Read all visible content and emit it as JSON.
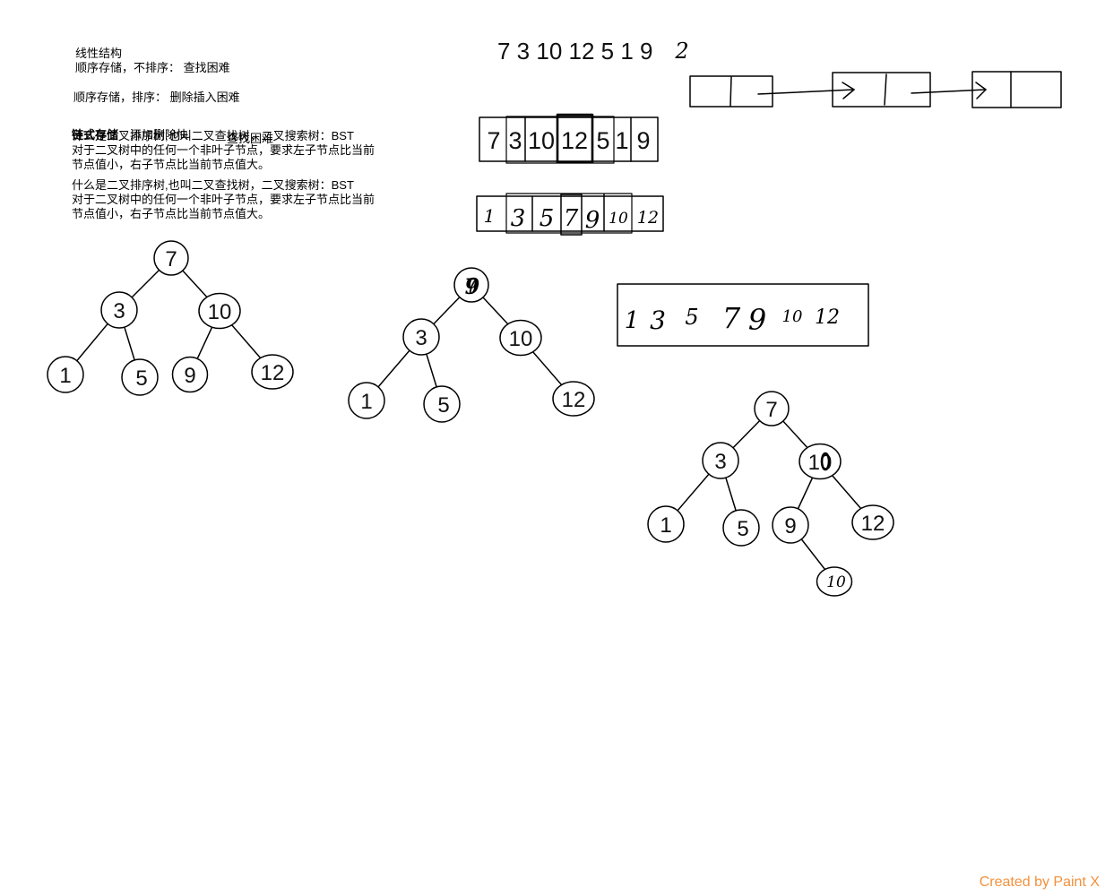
{
  "watermark": "Created by Paint X",
  "colors": {
    "canvas": "#ffffff",
    "ink": "#000000",
    "watermark": "#f2913d"
  },
  "notes": {
    "linear_title": "线性结构",
    "seq_unsorted": "顺序存储，不排序： 查找困难",
    "seq_sorted": "顺序存储，排序： 删除插入困难",
    "overlap": {
      "underlay": "什么是二叉排序树,也叫二叉查找树，二叉搜索树：BST",
      "linked": "链式存储",
      "linked_pro": "添加删除快",
      "linked_con": "查找困难"
    },
    "bst_rule_1": [
      "对于二叉树中的任何一个非叶子节点，要求左子节点比当前",
      "节点值小，右子节点比当前节点值大。"
    ],
    "bst_def": "什么是二叉排序树,也叫二叉查找树，二叉搜索树：BST",
    "bst_rule_2": [
      "对于二叉树中的任何一个非叶子节点，要求左子节点比当前",
      "节点值小，右子节点比当前节点值大。"
    ]
  },
  "sequence": {
    "typed": "7 3 10 12 5 1 9",
    "handwritten": "2"
  },
  "array_unsorted": [
    "7",
    "3",
    "10",
    "12",
    "5",
    "1",
    "9"
  ],
  "array_sorted": [
    "1",
    "3",
    "5",
    "7",
    "9",
    "10",
    "12"
  ],
  "sorted_box": [
    "1",
    "3",
    "5",
    "7",
    "9",
    "10",
    "12"
  ],
  "trees": [
    {
      "nodes": [
        "7",
        "3",
        "10",
        "1",
        "5",
        "9",
        "12"
      ]
    },
    {
      "nodes": [
        "7",
        "3",
        "10",
        "1",
        "5",
        "12"
      ],
      "root_overwrite": "9"
    },
    {
      "nodes": [
        "7",
        "3",
        "10",
        "1",
        "5",
        "9",
        "12",
        "10"
      ]
    }
  ]
}
